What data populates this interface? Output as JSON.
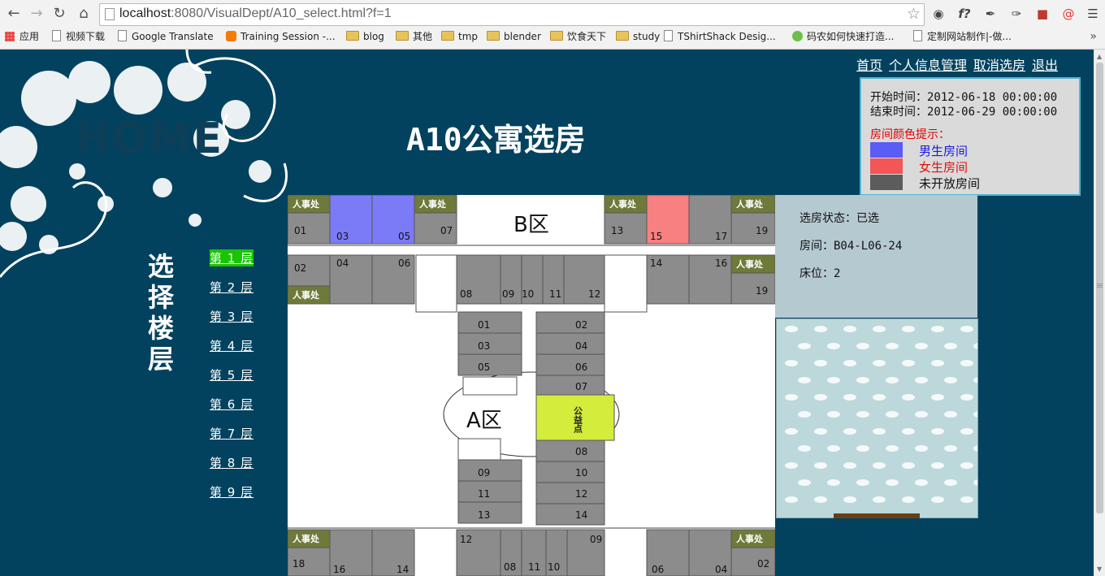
{
  "browser": {
    "url_host": "localhost",
    "url_rest": ":8080/VisualDept/A10_select.html?f=1",
    "bookmarks": [
      {
        "label": "应用",
        "icon": "apps-icon"
      },
      {
        "label": "视频下载",
        "icon": "page-icon"
      },
      {
        "label": "Google Translate",
        "icon": "page-icon"
      },
      {
        "label": "Training Session -...",
        "icon": "orange-icon"
      },
      {
        "label": "blog",
        "icon": "folder-icon"
      },
      {
        "label": "其他",
        "icon": "folder-icon"
      },
      {
        "label": "tmp",
        "icon": "folder-icon"
      },
      {
        "label": "blender",
        "icon": "folder-icon"
      },
      {
        "label": "饮食天下",
        "icon": "folder-icon"
      },
      {
        "label": "study",
        "icon": "folder-icon"
      },
      {
        "label": "TShirtShack Desig...",
        "icon": "page-icon"
      },
      {
        "label": "码农如何快速打造...",
        "icon": "flower-icon"
      },
      {
        "label": "定制网站制作|-做...",
        "icon": "page-icon"
      }
    ],
    "more_label": "»"
  },
  "header": {
    "logo": "HOME",
    "title": "A10公寓选房",
    "nav": [
      "首页",
      "个人信息管理",
      "取消选房",
      "退出"
    ]
  },
  "info": {
    "start": "开始时间：2012-06-18 00:00:00",
    "end": "结束时间：2012-06-29 00:00:00",
    "hint": "房间颜色提示：",
    "legend": [
      {
        "label": "男生房间",
        "color": "#5a5cf6",
        "text_color": "#1a1ae0"
      },
      {
        "label": "女生房间",
        "color": "#f25656",
        "text_color": "#e01010"
      },
      {
        "label": "未开放房间",
        "color": "#5c5c5c",
        "text_color": "#111111"
      }
    ]
  },
  "floors": {
    "heading": "选择楼层",
    "items": [
      "第 1 层",
      "第 2 层",
      "第 3 层",
      "第 4 层",
      "第 5 层",
      "第 6 层",
      "第 7 层",
      "第 8 层",
      "第 9 层"
    ],
    "active_index": 0
  },
  "status": {
    "state": "选房状态：已选",
    "room": "房间：B04-L06-24",
    "bed": "床位：2"
  },
  "plan": {
    "zone_b": "B区",
    "zone_a": "A区",
    "office": "人事处",
    "public": "公益点",
    "colors": {
      "closed": "#8c8c8c",
      "male": "#7b7bf7",
      "female": "#f88080",
      "office": "#6e7a3a",
      "public": "#d4ec3c"
    },
    "rooms": [
      {
        "n": "01"
      },
      {
        "n": "03"
      },
      {
        "n": "05"
      },
      {
        "n": "07"
      },
      {
        "n": "13"
      },
      {
        "n": "15"
      },
      {
        "n": "17"
      },
      {
        "n": "19"
      },
      {
        "n": "02"
      },
      {
        "n": "04"
      },
      {
        "n": "06"
      },
      {
        "n": "14"
      },
      {
        "n": "16"
      },
      {
        "n": "19"
      },
      {
        "n": "08"
      },
      {
        "n": "09"
      },
      {
        "n": "10"
      },
      {
        "n": "11"
      },
      {
        "n": "12"
      },
      {
        "n": "01"
      },
      {
        "n": "03"
      },
      {
        "n": "05"
      },
      {
        "n": "02"
      },
      {
        "n": "04"
      },
      {
        "n": "06"
      },
      {
        "n": "07"
      },
      {
        "n": "08"
      },
      {
        "n": "10"
      },
      {
        "n": "12"
      },
      {
        "n": "14"
      },
      {
        "n": "09"
      },
      {
        "n": "11"
      },
      {
        "n": "13"
      },
      {
        "n": "12"
      },
      {
        "n": "08"
      },
      {
        "n": "11"
      },
      {
        "n": "10"
      },
      {
        "n": "09"
      },
      {
        "n": "18"
      },
      {
        "n": "16"
      },
      {
        "n": "14"
      },
      {
        "n": "06"
      },
      {
        "n": "04"
      },
      {
        "n": "02"
      }
    ]
  }
}
